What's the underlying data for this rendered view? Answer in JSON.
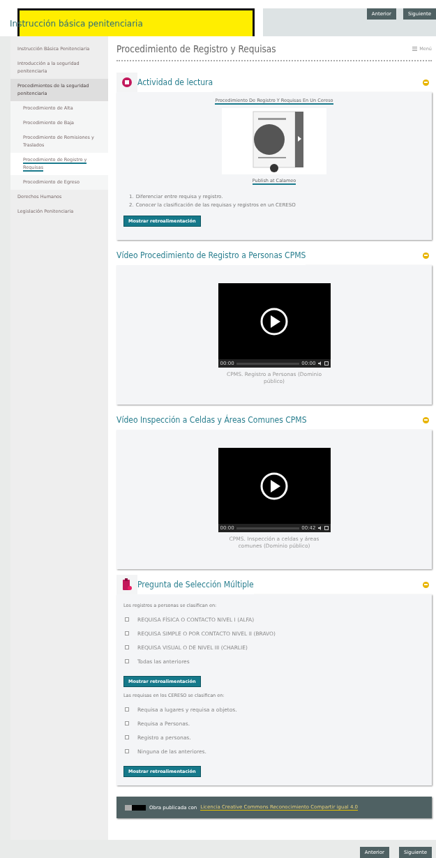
{
  "header": {
    "title": "Instrucción básica penitenciaria",
    "buttons": [
      "Anterior",
      "Siguiente"
    ]
  },
  "sidebar": {
    "items": [
      {
        "label": "Instrucción Básica Penitenciaria",
        "selected": false
      },
      {
        "label": "Introducción a la seguridad penitenciaria",
        "selected": false
      },
      {
        "label": "Procedimientos de la seguridad penitenciaria",
        "selected": false,
        "expanded": true,
        "children": [
          {
            "label": "Procedimiento de Alta",
            "selected": false
          },
          {
            "label": "Procedimiento de Baja",
            "selected": false
          },
          {
            "label": "Procedimiento de Remisiones y Traslados",
            "selected": false
          },
          {
            "label": "Procedimiento de Registro y Requisas",
            "selected": true
          },
          {
            "label": "Procedimiento de Egreso",
            "selected": false
          }
        ]
      },
      {
        "label": "Derechos Humanos",
        "selected": false
      },
      {
        "label": "Legislación Penitenciaria",
        "selected": false
      }
    ]
  },
  "page": {
    "title": "Procedimiento de Registro y Requisas",
    "menu": "Menú"
  },
  "sections": [
    {
      "kind": "reading",
      "title": "Actividad de lectura",
      "expanded": true,
      "link": "Procedimiento De Registro Y Requisas En Un Cereso",
      "publisher": "Publish at Calameo",
      "objectives": [
        {
          "marker": "1.",
          "text": "Diferenciar entre requisa y registro."
        },
        {
          "marker": "2.",
          "text": "Conocer la clasificación de las requisas y registros en un CERESO"
        }
      ],
      "button": "Mostrar retroalimentación"
    },
    {
      "kind": "video",
      "title": "Vídeo Procedimiento de Registro a Personas CPMS",
      "expanded": true,
      "time_start": "00:00",
      "time_end": "00:00",
      "caption": "CPMS. Registro a Personas (Dominio público)"
    },
    {
      "kind": "video",
      "title": "Vídeo Inspección a Celdas y Áreas Comunes CPMS",
      "expanded": true,
      "time_start": "00:00",
      "time_end": "00:42",
      "caption": "CPMS. Inspección a celdas y áreas comunes (Dominio público)"
    },
    {
      "kind": "quiz",
      "title": "Pregunta de Selección Múltiple",
      "expanded": true,
      "questions": [
        {
          "prompt": "Los registros a personas se clasifican en:",
          "options": [
            {
              "label": "REQUISA FÍSICA O CONTACTO NIVEL I (ALFA)",
              "checked": false
            },
            {
              "label": "REQUISA SIMPLE O POR CONTACTO NIVEL II (BRAVO)",
              "checked": false
            },
            {
              "label": "REQUISA VISUAL O DE NIVEL III (CHARLIE)",
              "checked": false
            },
            {
              "label": "Todas las anteriores",
              "checked": false
            }
          ],
          "button": "Mostrar retroalimentación"
        },
        {
          "prompt": "Las requisas en los CERESO se clasifican en:",
          "options": [
            {
              "label": "Requisa a lugares y requisa a objetos.",
              "checked": false
            },
            {
              "label": "Requisa a Personas.",
              "checked": false
            },
            {
              "label": "Registro a personas.",
              "checked": false
            },
            {
              "label": "Ninguna de las anteriores.",
              "checked": false
            }
          ],
          "button": "Mostrar retroalimentación"
        }
      ]
    }
  ],
  "license": {
    "text": "Obra publicada con",
    "link": "Licencia Creative Commons Reconocimiento Compartir igual 4.0"
  },
  "footer": {
    "buttons": [
      "Anterior",
      "Siguiente"
    ]
  }
}
